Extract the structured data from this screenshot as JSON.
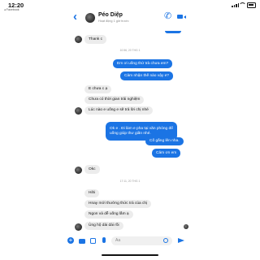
{
  "status_bar": {
    "time": "12:20",
    "back_app": "◂ Facebook"
  },
  "header": {
    "back_glyph": "‹",
    "contact_name": "Péo Diệp",
    "status": "Hoạt động 1 giờ trước",
    "phone_glyph": "✆"
  },
  "messages": {
    "m1": "Thank c",
    "ts1": "10:56, 20 THG 1",
    "m2": "Em ơi uống thử trà chưa em?",
    "m3": "Cảm nhận thế nào vậy e?",
    "m4": "E chưa c ạ",
    "m5": "Chưa có thời gian trải nghiệm",
    "m6": "Lúc nào e uống e sẽ trả lời chị nhé",
    "m7": "Ok e . Đi làm e pha tại văn phòng để",
    "m8": "uống giúp thư giãn nhé.",
    "m9": "Cố gắng lên nha.",
    "m10": "Cảm ơn em",
    "m11": "Okc",
    "ts2": "17:11, 20 THG 1",
    "m12": "Hihi",
    "m13": "Hnay mới thưởng thức trà của chị",
    "m14": "Ngon và dễ uống lắm ạ",
    "m15": "Ủng hộ dài dài rồi"
  },
  "composer": {
    "plus_glyph": "+",
    "placeholder": "Aa"
  }
}
